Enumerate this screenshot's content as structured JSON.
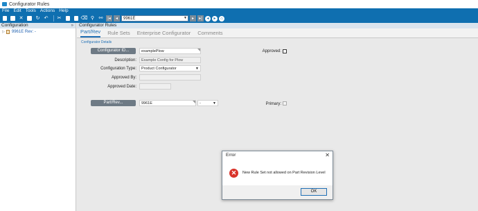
{
  "window": {
    "title": "Configurator Rules"
  },
  "menu": [
    "File",
    "Edit",
    "Tools",
    "Actions",
    "Help"
  ],
  "toolbar": {
    "record_value": "9961E",
    "icons": [
      "new-icon",
      "save-icon",
      "delete-icon",
      "save-all-icon",
      "refresh-icon",
      "undo-icon",
      "cut-icon",
      "copy-icon",
      "paste-icon",
      "clear-icon",
      "attach-icon",
      "search-icon"
    ]
  },
  "left_panel": {
    "header": "Configuration",
    "pin": "»",
    "tree_item": "9961E Rev: -"
  },
  "main": {
    "header": "Configurator Rules",
    "tabs": [
      "Part/Rev",
      "Rule Sets",
      "Enterprise Configurator",
      "Comments"
    ],
    "active_tab": "Part/Rev",
    "section": "Configurator Details",
    "configurator_id_button": "Configurator ID...",
    "configurator_id_value": "examplePlow",
    "description_label": "Description:",
    "description_value": "Example Config for Plow",
    "config_type_label": "Configuration Type:",
    "config_type_value": "Product Configurator",
    "approved_by_label": "Approved By:",
    "approved_by_value": "",
    "approved_date_label": "Approved Date:",
    "approved_date_value": "",
    "approved_label": "Approved:",
    "approved_checked": false,
    "part_rev_button": "Part/Rev...",
    "part_value": "9961E",
    "rev_value": "-",
    "primary_label": "Primary:",
    "primary_checked": false
  },
  "dialog": {
    "title": "Error",
    "close": "✕",
    "message": "New Rule Set not allowed on Part Revision Level",
    "ok": "OK",
    "icon_glyph": "✕"
  },
  "colors": {
    "accent": "#0f6fb0",
    "error": "#d9342b"
  }
}
